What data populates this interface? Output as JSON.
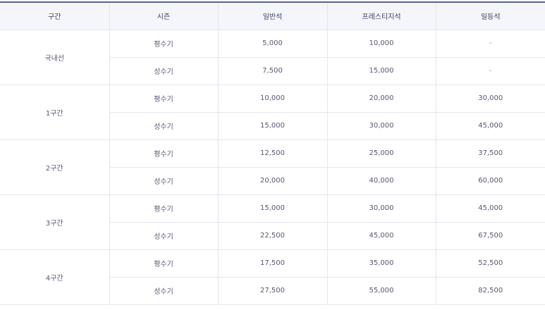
{
  "table": {
    "headers": [
      "구간",
      "시즌",
      "일반석",
      "프레스티지석",
      "일등석"
    ],
    "sections": [
      {
        "name": "국내선",
        "rows": [
          {
            "season": "평수기",
            "economy": "5,000",
            "prestige": "10,000",
            "first": "-"
          },
          {
            "season": "성수기",
            "economy": "7,500",
            "prestige": "15,000",
            "first": "-"
          }
        ]
      },
      {
        "name": "1구간",
        "rows": [
          {
            "season": "평수기",
            "economy": "10,000",
            "prestige": "20,000",
            "first": "30,000"
          },
          {
            "season": "성수기",
            "economy": "15,000",
            "prestige": "30,000",
            "first": "45,000"
          }
        ]
      },
      {
        "name": "2구간",
        "rows": [
          {
            "season": "평수기",
            "economy": "12,500",
            "prestige": "25,000",
            "first": "37,500"
          },
          {
            "season": "성수기",
            "economy": "20,000",
            "prestige": "40,000",
            "first": "60,000"
          }
        ]
      },
      {
        "name": "3구간",
        "rows": [
          {
            "season": "평수기",
            "economy": "15,000",
            "prestige": "30,000",
            "first": "45,000"
          },
          {
            "season": "성수기",
            "economy": "22,500",
            "prestige": "45,000",
            "first": "67,500"
          }
        ]
      },
      {
        "name": "4구간",
        "rows": [
          {
            "season": "평수기",
            "economy": "17,500",
            "prestige": "35,000",
            "first": "52,500"
          },
          {
            "season": "성수기",
            "economy": "27,500",
            "prestige": "55,000",
            "first": "82,500"
          }
        ]
      }
    ]
  }
}
